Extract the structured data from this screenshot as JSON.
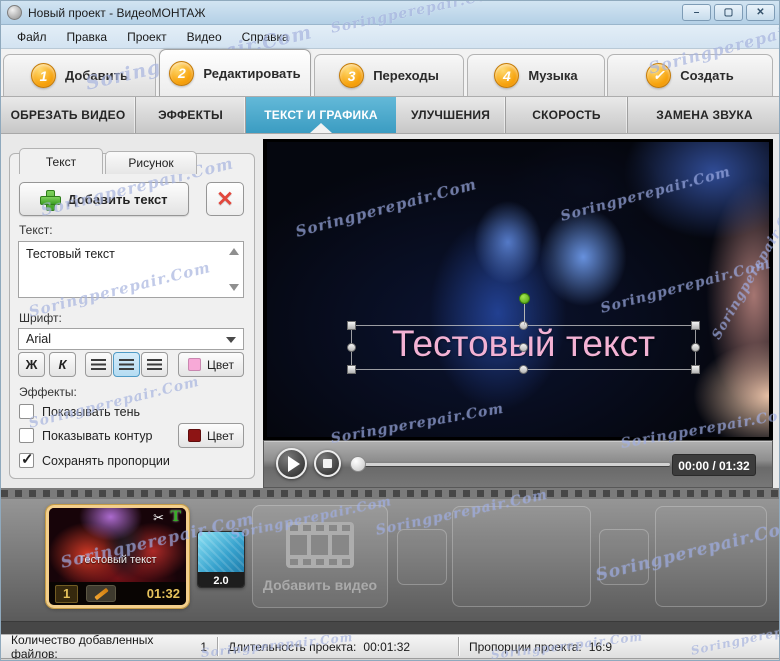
{
  "window": {
    "title": "Новый проект - ВидеоМОНТАЖ",
    "minimize_glyph": "–",
    "maximize_glyph": "▢",
    "close_glyph": "✕"
  },
  "menu": {
    "items": [
      "Файл",
      "Правка",
      "Проект",
      "Видео",
      "Справка"
    ]
  },
  "steps": [
    {
      "badge": "1",
      "label": "Добавить"
    },
    {
      "badge": "2",
      "label": "Редактировать"
    },
    {
      "badge": "3",
      "label": "Переходы"
    },
    {
      "badge": "4",
      "label": "Музыка"
    },
    {
      "badge": "✓",
      "label": "Создать"
    }
  ],
  "subtabs": {
    "items": [
      "ОБРЕЗАТЬ ВИДЕО",
      "ЭФФЕКТЫ",
      "ТЕКСТ И ГРАФИКА",
      "УЛУЧШЕНИЯ",
      "СКОРОСТЬ",
      "ЗАМЕНА ЗВУКА"
    ],
    "active": "ТЕКСТ И ГРАФИКА"
  },
  "panel": {
    "tab_text": "Текст",
    "tab_picture": "Рисунок",
    "add_text_button": "Добавить текст",
    "delete_glyph": "✕",
    "text_label": "Текст:",
    "text_value": "Тестовый текст",
    "font_label": "Шрифт:",
    "font_value": "Arial",
    "bold_glyph": "Ж",
    "italic_glyph": "К",
    "text_color_button": "Цвет",
    "text_color": "#f7a9d7",
    "effects_label": "Эффекты:",
    "cb_shadow": "Показывать тень",
    "cb_contour": "Показывать контур",
    "contour_color_button": "Цвет",
    "contour_color": "#8d1414",
    "cb_proportions": "Сохранять пропорции",
    "check_glyph": "✓"
  },
  "preview": {
    "overlay_text": "Тестовый текст",
    "time": "00:00 / 01:32"
  },
  "timeline": {
    "clip_number": "1",
    "clip_duration": "01:32",
    "clip_overlay": "Тестовый текст",
    "scissors_glyph": "✂",
    "text_tool_glyph": "T",
    "transition_duration": "2.0",
    "add_video_button": "Добавить видео"
  },
  "statusbar": {
    "files_label": "Количество добавленных файлов:",
    "files_value": "1",
    "duration_label": "Длительность проекта:",
    "duration_value": "00:01:32",
    "aspect_label": "Пропорции проекта:",
    "aspect_value": "16:9"
  },
  "watermark": "Soringperepair.Com",
  "colors": {
    "accent_blue": "#46a5c9",
    "badge_orange": "#f7a30e",
    "overlay_text_pink": "#f3b2d4",
    "clip_border_gold": "#f3cf8c"
  }
}
